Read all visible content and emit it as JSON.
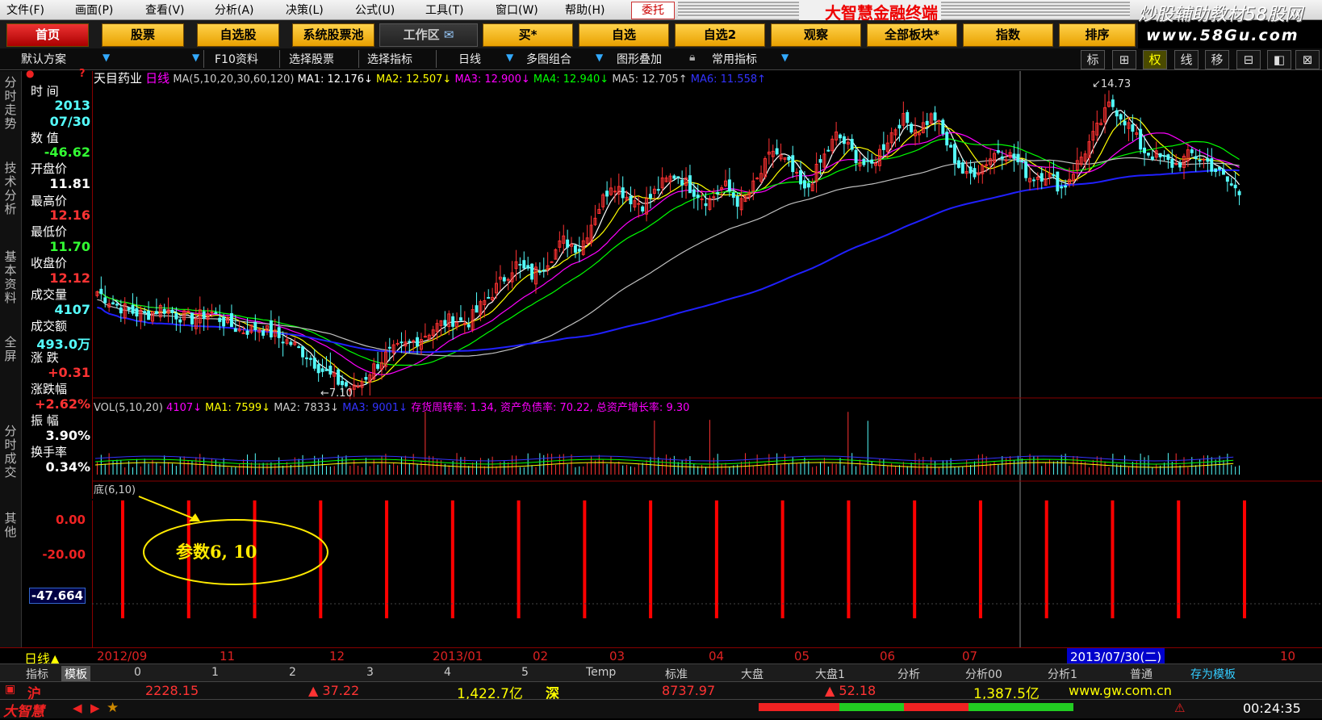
{
  "menu": [
    "文件(F)",
    "画面(P)",
    "查看(V)",
    "分析(A)",
    "决策(L)",
    "公式(U)",
    "工具(T)",
    "窗口(W)",
    "帮助(H)"
  ],
  "weituo": "委托",
  "brand": "大智慧金融终端",
  "watermark": {
    "line1": "炒股辅助教材58股网",
    "line2": "www.58Gu.com"
  },
  "nav": [
    "首页",
    "股票",
    "自选股",
    "系统股票池",
    "工作区",
    "买*",
    "自选",
    "自选2",
    "观察",
    "全部板块*",
    "指数",
    "排序"
  ],
  "toolbar": {
    "scheme": "默认方案",
    "items": [
      "F10资料",
      "选择股票",
      "选择指标",
      "日线",
      "多图组合",
      "图形叠加",
      "常用指标"
    ],
    "right": [
      "标",
      "⊞",
      "权",
      "线",
      "移",
      "⊟",
      "◧",
      "⊠"
    ]
  },
  "tabs": [
    "分时走势",
    "技术分析",
    "基本资料",
    "全屏",
    "分时成交",
    "其他"
  ],
  "info": {
    "time_label": "时  间",
    "year": "2013",
    "date": "07/30",
    "value_label": "数  值",
    "value": "-46.62",
    "open_label": "开盘价",
    "open": "11.81",
    "high_label": "最高价",
    "high": "12.16",
    "low_label": "最低价",
    "low": "11.70",
    "close_label": "收盘价",
    "close": "12.12",
    "volume_label": "成交量",
    "volume": "4107",
    "amount_label": "成交额",
    "amount": "493.0万",
    "change_label": "涨  跌",
    "change": "+0.31",
    "pct_label": "涨跌幅",
    "pct": "+2.62%",
    "amp_label": "振  幅",
    "amp": "3.90%",
    "turnover_label": "换手率",
    "turnover": "0.34%"
  },
  "legend_ma": {
    "stock": "天目药业",
    "period": "日线",
    "params": "MA(5,10,20,30,60,120)",
    "ma1": "MA1: 12.176↓",
    "ma2": "MA2: 12.507↓",
    "ma3": "MA3: 12.900↓",
    "ma4": "MA4: 12.940↓",
    "ma5": "MA5: 12.705↑",
    "ma6": "MA6: 11.558↑"
  },
  "legend_vol": {
    "params": "VOL(5,10,20)",
    "vol": "4107↓",
    "ma1": "MA1: 7599↓",
    "ma2": "MA2: 7833↓",
    "ma3": "MA3: 9001↓",
    "extra": "存货周转率: 1.34, 资产负债率: 70.22, 总资产增长率: 9.30"
  },
  "indicator": {
    "name": "底(6,10)",
    "note": "参数6, 10",
    "axis": [
      "0.00",
      "-20.00",
      "-47.664"
    ]
  },
  "price_marks": {
    "high": "14.73",
    "low": "7.10"
  },
  "colors": {
    "up": "#ff3232",
    "down": "#54fcfc",
    "ma1": "#ffffff",
    "ma2": "#ffff00",
    "ma3": "#ff00ff",
    "ma4": "#00ff00",
    "ma5": "#c0c0c0",
    "ma6": "#2020ff"
  },
  "chart_data": {
    "type": "candlestick",
    "period_label": "日线",
    "date_labels": [
      "2012/09",
      "11",
      "12",
      "2013/01",
      "02",
      "03",
      "04",
      "05",
      "06",
      "07",
      "2013/07/30(二)",
      "10"
    ],
    "ylim": [
      7.0,
      15.0
    ],
    "price_path": [
      9.6,
      9.3,
      9.1,
      9.0,
      9.2,
      9.0,
      8.9,
      9.1,
      8.8,
      8.6,
      8.7,
      8.5,
      8.3,
      8.0,
      7.6,
      7.3,
      7.1,
      7.6,
      8.0,
      8.2,
      8.4,
      8.7,
      8.9,
      8.8,
      9.3,
      9.8,
      10.3,
      10.0,
      10.4,
      10.9,
      10.7,
      11.6,
      12.4,
      12.0,
      11.8,
      12.3,
      12.6,
      12.2,
      11.9,
      12.3,
      11.8,
      12.4,
      13.2,
      12.8,
      12.1,
      12.9,
      13.6,
      13.1,
      12.7,
      13.4,
      14.0,
      13.7,
      14.1,
      13.2,
      12.5,
      12.8,
      13.2,
      13.0,
      12.5,
      12.6,
      12.2,
      12.9,
      13.6,
      14.4,
      13.9,
      13.2,
      13.0,
      12.8,
      13.1,
      12.9,
      12.5,
      12.1
    ]
  },
  "indicator_bars": {
    "count": 18
  },
  "templates": [
    "指标",
    "模板",
    "0",
    "1",
    "2",
    "3",
    "4",
    "5",
    "Temp",
    "标准",
    "大盘",
    "大盘1",
    "分析",
    "分析00",
    "分析1",
    "普通",
    "存为模板"
  ],
  "quote": {
    "sh_label": "沪",
    "sh_index": "2228.15",
    "sh_change": "▲ 37.22",
    "sh_amount": "1,422.7亿",
    "sz_label": "深",
    "sz_index": "8737.97",
    "sz_change": "▲ 52.18",
    "sz_amount": "1,387.5亿",
    "site": "www.gw.com.cn"
  },
  "status": {
    "brand": "大智慧",
    "time": "00:24:35"
  }
}
